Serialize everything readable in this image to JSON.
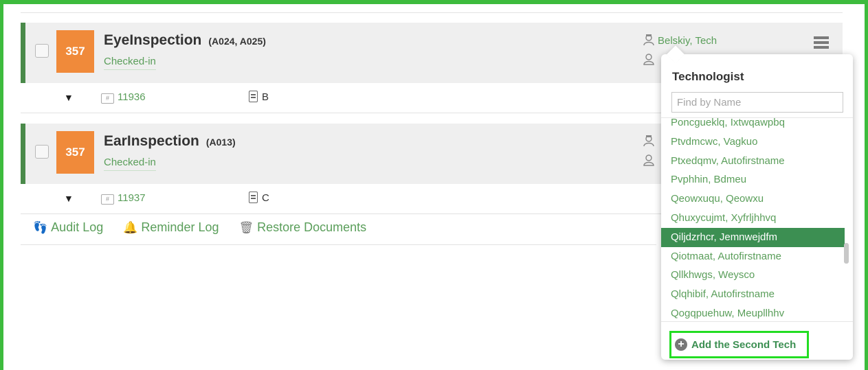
{
  "orders": [
    {
      "number": "357",
      "procedure": "EyeInspection",
      "codes": "(A024, A025)",
      "status": "Checked-in",
      "technologist": "Belskiy, Tech",
      "accession": "11936",
      "document": "B"
    },
    {
      "number": "357",
      "procedure": "EarInspection",
      "codes": "(A013)",
      "status": "Checked-in",
      "accession": "11937",
      "document": "C"
    }
  ],
  "footer_links": {
    "audit_log": "Audit Log",
    "reminder_log": "Reminder Log",
    "restore_documents": "Restore Documents"
  },
  "tech_popup": {
    "title": "Technologist",
    "search_placeholder": "Find by Name",
    "items": [
      "Poncgueklq, Ixtwqawpbq",
      "Ptvdmcwc, Vagkuo",
      "Ptxedqmv, Autofirstname",
      "Pvphhin, Bdmeu",
      "Qeowxuqu, Qeowxu",
      "Qhuxycujmt, Xyfrljhhvq",
      "Qiljdzrhcr, Jemnwejdfm",
      "Qiotmaat, Autofirstname",
      "Qllkhwgs, Weysco",
      "Qlqhibif, Autofirstname",
      "Qogqpuehuw, Meupllhhv"
    ],
    "selected_index": 6,
    "add_button": "Add the Second Tech"
  },
  "colors": {
    "accent_green": "#5a9e5a",
    "highlight_border": "#22dd22",
    "order_number_bg": "#f08a3a",
    "selected_bg": "#3c8f52"
  }
}
